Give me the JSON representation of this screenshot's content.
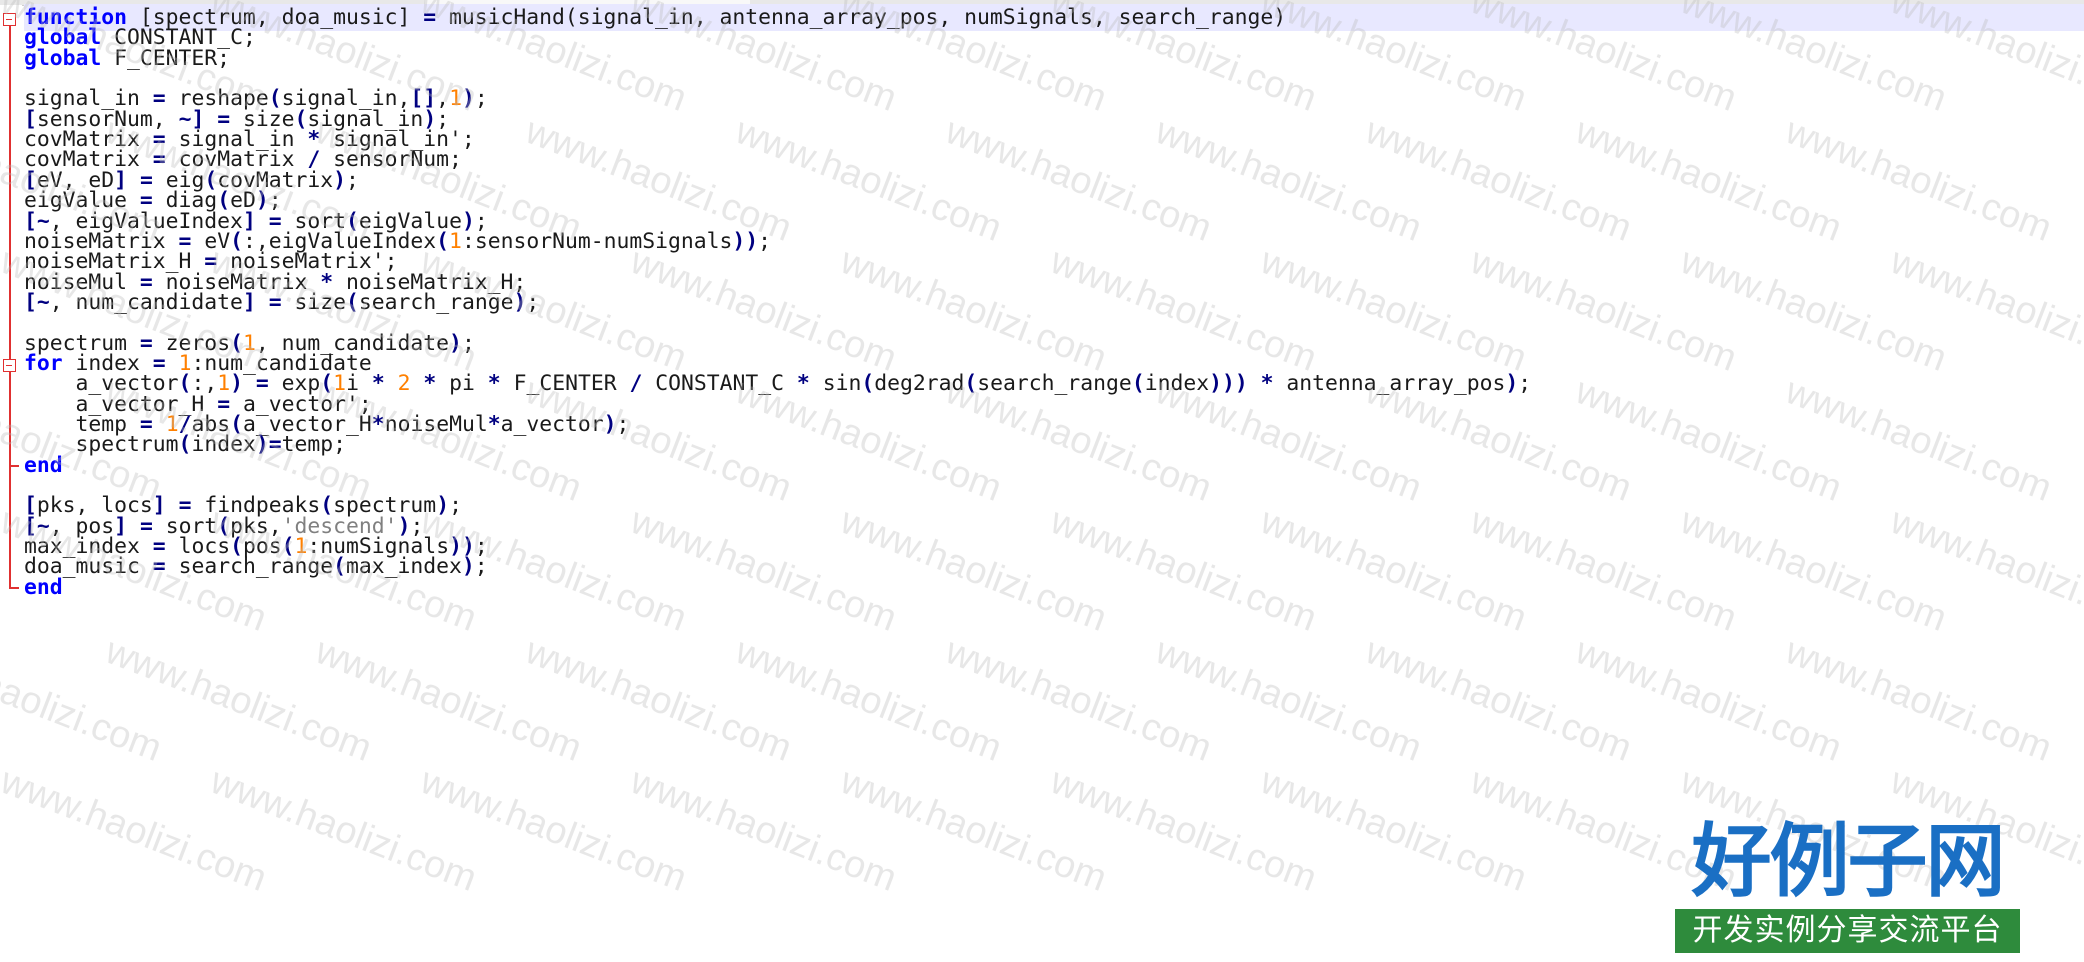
{
  "editor": {
    "lines": [
      [
        [
          "kw",
          "function"
        ],
        [
          "t",
          " [spectrum, doa_music] "
        ],
        [
          "op",
          "="
        ],
        [
          "t",
          " musicHand(signal_in, antenna_array_pos, numSignals, search_range)"
        ]
      ],
      [
        [
          "kw",
          "global"
        ],
        [
          "t",
          " CONSTANT_C;"
        ]
      ],
      [
        [
          "kw",
          "global"
        ],
        [
          "t",
          " F_CENTER;"
        ]
      ],
      [],
      [
        [
          "t",
          "signal_in "
        ],
        [
          "op",
          "="
        ],
        [
          "t",
          " reshape"
        ],
        [
          "op",
          "("
        ],
        [
          "t",
          "signal_in,"
        ],
        [
          "op",
          "[]"
        ],
        [
          "t",
          ","
        ],
        [
          "num",
          "1"
        ],
        [
          "op",
          ")"
        ],
        [
          "t",
          ";"
        ]
      ],
      [
        [
          "op",
          "["
        ],
        [
          "t",
          "sensorNum, "
        ],
        [
          "op",
          "~]"
        ],
        [
          "t",
          " "
        ],
        [
          "op",
          "="
        ],
        [
          "t",
          " size"
        ],
        [
          "op",
          "("
        ],
        [
          "t",
          "signal_in"
        ],
        [
          "op",
          ")"
        ],
        [
          "t",
          ";"
        ]
      ],
      [
        [
          "t",
          "covMatrix "
        ],
        [
          "op",
          "="
        ],
        [
          "t",
          " signal_in "
        ],
        [
          "op",
          "*"
        ],
        [
          "t",
          " signal_in';"
        ]
      ],
      [
        [
          "t",
          "covMatrix "
        ],
        [
          "op",
          "="
        ],
        [
          "t",
          " covMatrix "
        ],
        [
          "op",
          "/"
        ],
        [
          "t",
          " sensorNum;"
        ]
      ],
      [
        [
          "op",
          "["
        ],
        [
          "t",
          "eV, eD"
        ],
        [
          "op",
          "]"
        ],
        [
          "t",
          " "
        ],
        [
          "op",
          "="
        ],
        [
          "t",
          " eig"
        ],
        [
          "op",
          "("
        ],
        [
          "t",
          "covMatrix"
        ],
        [
          "op",
          ")"
        ],
        [
          "t",
          ";"
        ]
      ],
      [
        [
          "t",
          "eigValue "
        ],
        [
          "op",
          "="
        ],
        [
          "t",
          " diag"
        ],
        [
          "op",
          "("
        ],
        [
          "t",
          "eD"
        ],
        [
          "op",
          ")"
        ],
        [
          "t",
          ";"
        ]
      ],
      [
        [
          "op",
          "[~"
        ],
        [
          "t",
          ", eigValueIndex"
        ],
        [
          "op",
          "]"
        ],
        [
          "t",
          " "
        ],
        [
          "op",
          "="
        ],
        [
          "t",
          " sort"
        ],
        [
          "op",
          "("
        ],
        [
          "t",
          "eigValue"
        ],
        [
          "op",
          ")"
        ],
        [
          "t",
          ";"
        ]
      ],
      [
        [
          "t",
          "noiseMatrix "
        ],
        [
          "op",
          "="
        ],
        [
          "t",
          " eV"
        ],
        [
          "op",
          "("
        ],
        [
          "t",
          ":,eigValueIndex"
        ],
        [
          "op",
          "("
        ],
        [
          "num",
          "1"
        ],
        [
          "t",
          ":sensorNum-numSignals"
        ],
        [
          "op",
          "))"
        ],
        [
          "t",
          ";"
        ]
      ],
      [
        [
          "t",
          "noiseMatrix_H "
        ],
        [
          "op",
          "="
        ],
        [
          "t",
          " noiseMatrix';"
        ]
      ],
      [
        [
          "t",
          "noiseMul "
        ],
        [
          "op",
          "="
        ],
        [
          "t",
          " noiseMatrix "
        ],
        [
          "op",
          "*"
        ],
        [
          "t",
          " noiseMatrix_H;"
        ]
      ],
      [
        [
          "op",
          "[~"
        ],
        [
          "t",
          ", num_candidate"
        ],
        [
          "op",
          "]"
        ],
        [
          "t",
          " "
        ],
        [
          "op",
          "="
        ],
        [
          "t",
          " size"
        ],
        [
          "op",
          "("
        ],
        [
          "t",
          "search_range"
        ],
        [
          "op",
          ")"
        ],
        [
          "t",
          ";"
        ]
      ],
      [],
      [
        [
          "t",
          "spectrum "
        ],
        [
          "op",
          "="
        ],
        [
          "t",
          " zeros"
        ],
        [
          "op",
          "("
        ],
        [
          "num",
          "1"
        ],
        [
          "t",
          ", num_candidate"
        ],
        [
          "op",
          ")"
        ],
        [
          "t",
          ";"
        ]
      ],
      [
        [
          "kw",
          "for"
        ],
        [
          "t",
          " index "
        ],
        [
          "op",
          "="
        ],
        [
          "t",
          " "
        ],
        [
          "num",
          "1"
        ],
        [
          "t",
          ":num_candidate"
        ]
      ],
      [
        [
          "t",
          "    a_vector"
        ],
        [
          "op",
          "("
        ],
        [
          "t",
          ":,"
        ],
        [
          "num",
          "1"
        ],
        [
          "op",
          ")"
        ],
        [
          "t",
          " "
        ],
        [
          "op",
          "="
        ],
        [
          "t",
          " exp"
        ],
        [
          "op",
          "("
        ],
        [
          "num",
          "1"
        ],
        [
          "t",
          "i "
        ],
        [
          "op",
          "*"
        ],
        [
          "t",
          " "
        ],
        [
          "num",
          "2"
        ],
        [
          "t",
          " "
        ],
        [
          "op",
          "*"
        ],
        [
          "t",
          " pi "
        ],
        [
          "op",
          "*"
        ],
        [
          "t",
          " F_CENTER "
        ],
        [
          "op",
          "/"
        ],
        [
          "t",
          " CONSTANT_C "
        ],
        [
          "op",
          "*"
        ],
        [
          "t",
          " sin"
        ],
        [
          "op",
          "("
        ],
        [
          "t",
          "deg2rad"
        ],
        [
          "op",
          "("
        ],
        [
          "t",
          "search_range"
        ],
        [
          "op",
          "("
        ],
        [
          "t",
          "index"
        ],
        [
          "op",
          ")))"
        ],
        [
          "t",
          " "
        ],
        [
          "op",
          "*"
        ],
        [
          "t",
          " antenna_array_pos"
        ],
        [
          "op",
          ")"
        ],
        [
          "t",
          ";"
        ]
      ],
      [
        [
          "t",
          "    a_vector_H "
        ],
        [
          "op",
          "="
        ],
        [
          "t",
          " a_vector';"
        ]
      ],
      [
        [
          "t",
          "    temp "
        ],
        [
          "op",
          "="
        ],
        [
          "t",
          " "
        ],
        [
          "num",
          "1"
        ],
        [
          "op",
          "/"
        ],
        [
          "t",
          "abs"
        ],
        [
          "op",
          "("
        ],
        [
          "t",
          "a_vector_H"
        ],
        [
          "op",
          "*"
        ],
        [
          "t",
          "noiseMul"
        ],
        [
          "op",
          "*"
        ],
        [
          "t",
          "a_vector"
        ],
        [
          "op",
          ")"
        ],
        [
          "t",
          ";"
        ]
      ],
      [
        [
          "t",
          "    spectrum"
        ],
        [
          "op",
          "("
        ],
        [
          "t",
          "index"
        ],
        [
          "op",
          ")="
        ],
        [
          "t",
          "temp;"
        ]
      ],
      [
        [
          "kw",
          "end"
        ]
      ],
      [],
      [
        [
          "op",
          "["
        ],
        [
          "t",
          "pks, locs"
        ],
        [
          "op",
          "]"
        ],
        [
          "t",
          " "
        ],
        [
          "op",
          "="
        ],
        [
          "t",
          " findpeaks"
        ],
        [
          "op",
          "("
        ],
        [
          "t",
          "spectrum"
        ],
        [
          "op",
          ")"
        ],
        [
          "t",
          ";"
        ]
      ],
      [
        [
          "op",
          "[~"
        ],
        [
          "t",
          ", pos"
        ],
        [
          "op",
          "]"
        ],
        [
          "t",
          " "
        ],
        [
          "op",
          "="
        ],
        [
          "t",
          " sort"
        ],
        [
          "op",
          "("
        ],
        [
          "t",
          "pks,"
        ],
        [
          "str",
          "'descend'"
        ],
        [
          "op",
          ")"
        ],
        [
          "t",
          ";"
        ]
      ],
      [
        [
          "t",
          "max_index "
        ],
        [
          "op",
          "="
        ],
        [
          "t",
          " locs"
        ],
        [
          "op",
          "("
        ],
        [
          "t",
          "pos"
        ],
        [
          "op",
          "("
        ],
        [
          "num",
          "1"
        ],
        [
          "t",
          ":numSignals"
        ],
        [
          "op",
          "))"
        ],
        [
          "t",
          ";"
        ]
      ],
      [
        [
          "t",
          "doa_music "
        ],
        [
          "op",
          "="
        ],
        [
          "t",
          " search_range"
        ],
        [
          "op",
          "("
        ],
        [
          "t",
          "max_index"
        ],
        [
          "op",
          ")"
        ],
        [
          "t",
          ";"
        ]
      ],
      [
        [
          "kw",
          "end"
        ]
      ]
    ]
  },
  "watermark": {
    "text": "www.haolizi.com"
  },
  "logo": {
    "title": "好例子网",
    "subtitle": "开发实例分享交流平台",
    "colors": {
      "title": "#1a6fc4",
      "subtitle_bg": "#2e8b3c"
    }
  },
  "colors": {
    "keyword": "#0000ff",
    "number": "#ff8000",
    "operator": "#000080",
    "string": "#808080",
    "fold_marker": "#e03030",
    "current_line": "#e8e8ff"
  }
}
